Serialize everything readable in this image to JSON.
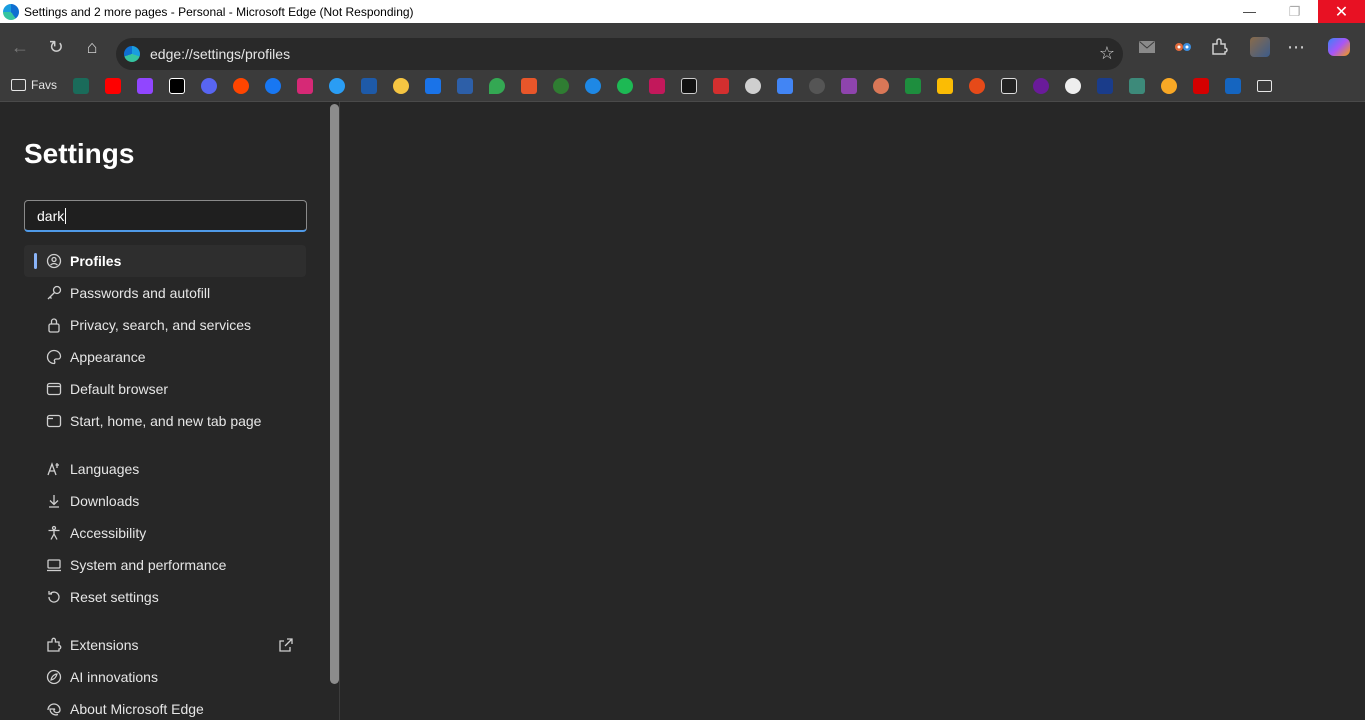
{
  "window": {
    "title": "Settings and 2 more pages - Personal - Microsoft Edge (Not Responding)",
    "min_glyph": "—",
    "max_glyph": "❐",
    "close_glyph": "✕"
  },
  "toolbar": {
    "url": "edge://settings/profiles",
    "back_glyph": "←",
    "refresh_glyph": "↻",
    "home_glyph": "⌂",
    "star_glyph": "☆",
    "more_glyph": "⋯"
  },
  "favorites": {
    "folder_label": "Favs"
  },
  "sidebar": {
    "title": "Settings",
    "search_value": "dark",
    "items": [
      {
        "label": "Profiles"
      },
      {
        "label": "Passwords and autofill"
      },
      {
        "label": "Privacy, search, and services"
      },
      {
        "label": "Appearance"
      },
      {
        "label": "Default browser"
      },
      {
        "label": "Start, home, and new tab page"
      },
      {
        "label": "Languages"
      },
      {
        "label": "Downloads"
      },
      {
        "label": "Accessibility"
      },
      {
        "label": "System and performance"
      },
      {
        "label": "Reset settings"
      },
      {
        "label": "Extensions"
      },
      {
        "label": "AI innovations"
      },
      {
        "label": "About Microsoft Edge"
      }
    ]
  },
  "colors": {
    "accent": "#8ab4f8",
    "background": "#272727",
    "toolbar": "#3b3b3b",
    "close": "#e81123"
  }
}
